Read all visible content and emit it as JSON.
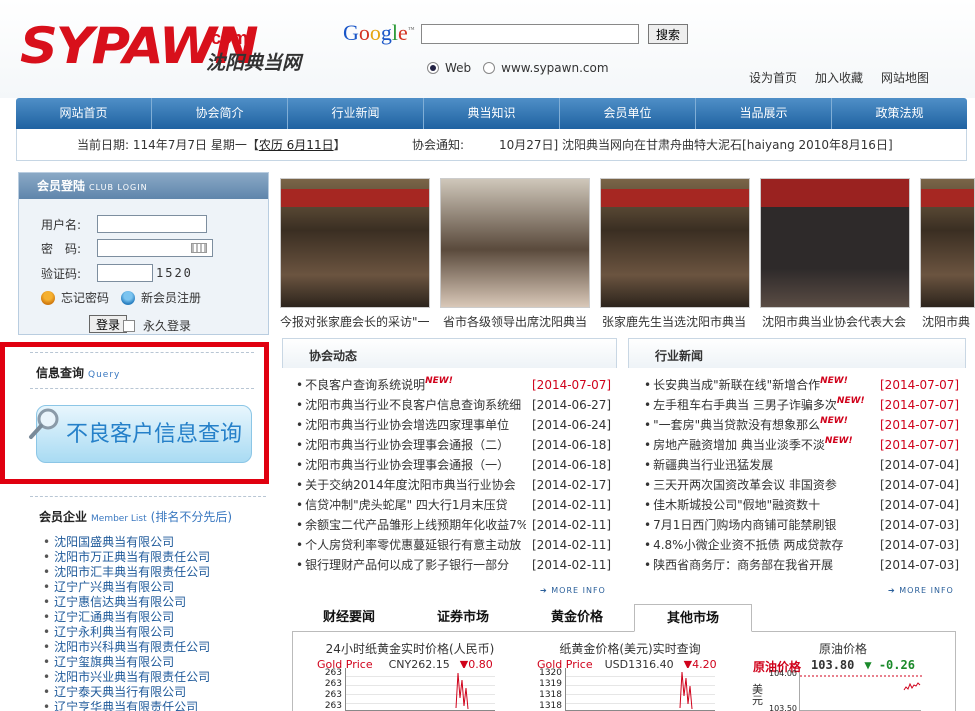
{
  "header": {
    "logo_main": "SYPAWN",
    "logo_com": ".com",
    "logo_cn": "沈阳典当网",
    "google_logo": "Google",
    "search_button": "搜索",
    "radio_web": "Web",
    "radio_site": "www.sypawn.com",
    "links": [
      "设为首页",
      "加入收藏",
      "网站地图"
    ]
  },
  "nav": [
    "网站首页",
    "协会简介",
    "行业新闻",
    "典当知识",
    "会员单位",
    "当品展示",
    "政策法规"
  ],
  "infobar": {
    "date_prefix": "当前日期: 114年7月7日 星期一【",
    "lunar_date": "农历 6月11日",
    "date_suffix": "】",
    "notice_label": "协会通知:",
    "notice_text": "10月27日] 沈阳典当网向在甘肃舟曲特大泥石[haiyang 2010年8月16日]"
  },
  "login": {
    "title": "会员登陆",
    "title_en": "CLUB LOGIN",
    "username_label": "用户名:",
    "password_label": "密　码:",
    "captcha_label": "验证码:",
    "captcha_code": "1520",
    "forgot": "忘记密码",
    "register": "新会员注册",
    "login_button": "登录",
    "remember": "永久登录"
  },
  "query": {
    "title": "信息查询",
    "title_en": "Query",
    "button": "不良客户信息查询"
  },
  "members": {
    "title": "会员企业",
    "title_en": "Member List",
    "note": "(排名不分先后)",
    "items": [
      "沈阳国盛典当有限公司",
      "沈阳市万正典当有限责任公司",
      "沈阳市汇丰典当有限责任公司",
      "辽宁广兴典当有限公司",
      "辽宁惠信达典当有限公司",
      "辽宁汇通典当有限公司",
      "辽宁永利典当有限公司",
      "沈阳市兴科典当有限责任公司",
      "辽宁玺旗典当有限公司",
      "沈阳市兴业典当有限责任公司",
      "辽宁泰天典当行有限公司",
      "辽宁亨华典当有限责任公司"
    ]
  },
  "photos": [
    "今报对张家鹿会长的采访\"一",
    "省市各级领导出席沈阳典当",
    "张家鹿先生当选沈阳市典当",
    "沈阳市典当业协会代表大会",
    "沈阳市典"
  ],
  "association_news": {
    "title": "协会动态",
    "new_tag": "NEW!",
    "items": [
      {
        "text": "不良客户查询系统说明",
        "date": "[2014-07-07]",
        "new": true
      },
      {
        "text": "沈阳市典当行业不良客户信息查询系统细",
        "date": "[2014-06-27]",
        "new": false
      },
      {
        "text": "沈阳市典当行业协会增选四家理事单位",
        "date": "[2014-06-24]",
        "new": false
      },
      {
        "text": "沈阳市典当行业协会理事会通报（二）",
        "date": "[2014-06-18]",
        "new": false
      },
      {
        "text": "沈阳市典当行业协会理事会通报（一）",
        "date": "[2014-06-18]",
        "new": false
      },
      {
        "text": "关于交纳2014年度沈阳市典当行业协会",
        "date": "[2014-02-17]",
        "new": false
      },
      {
        "text": "信贷冲制\"虎头蛇尾\" 四大行1月末压贷",
        "date": "[2014-02-11]",
        "new": false
      },
      {
        "text": "余额宝二代产品雏形上线预期年化收益7%",
        "date": "[2014-02-11]",
        "new": false
      },
      {
        "text": "个人房贷利率零优惠蔓延银行有意主动放",
        "date": "[2014-02-11]",
        "new": false
      },
      {
        "text": "银行理财产品何以成了影子银行一部分",
        "date": "[2014-02-11]",
        "new": false
      }
    ],
    "more": "MORE INFO"
  },
  "industry_news": {
    "title": "行业新闻",
    "items": [
      {
        "text": "长安典当成\"新联在线\"新增合作",
        "date": "[2014-07-07]",
        "new": true
      },
      {
        "text": "左手租车右手典当 三男子诈骗多次",
        "date": "[2014-07-07]",
        "new": true
      },
      {
        "text": "\"一套房\"典当贷款没有想象那么",
        "date": "[2014-07-07]",
        "new": true
      },
      {
        "text": "房地产融资增加 典当业淡季不淡",
        "date": "[2014-07-07]",
        "new": true
      },
      {
        "text": "新疆典当行业迅猛发展",
        "date": "[2014-07-04]",
        "new": false
      },
      {
        "text": "三天开两次国资改革会议 非国资参",
        "date": "[2014-07-04]",
        "new": false
      },
      {
        "text": "佳木斯城投公司\"假地\"融资数十",
        "date": "[2014-07-04]",
        "new": false
      },
      {
        "text": "7月1日西门购场内商铺可能禁刷银",
        "date": "[2014-07-03]",
        "new": false
      },
      {
        "text": "4.8%小微企业资不抵债 两成贷款存",
        "date": "[2014-07-03]",
        "new": false
      },
      {
        "text": "陕西省商务厅：商务部在我省开展",
        "date": "[2014-07-03]",
        "new": false
      }
    ],
    "more": "MORE INFO"
  },
  "market_tabs": [
    "财经要闻",
    "证券市场",
    "黄金价格",
    "其他市场"
  ],
  "market": {
    "paper_gold_rmb": {
      "title": "24小时纸黄金实时价格(人民币)",
      "label": "Gold Price",
      "price": "CNY262.15",
      "change": "0.80",
      "ticks": [
        "263",
        "263",
        "263",
        "263"
      ]
    },
    "paper_gold_usd": {
      "title": "纸黄金价格(美元)实时查询",
      "label": "Gold Price",
      "price": "USD1316.40",
      "change": "4.20",
      "ticks": [
        "1320",
        "1319",
        "1318",
        "1318"
      ]
    },
    "oil": {
      "title": "原油价格",
      "label": "原油价格",
      "price": "103.80",
      "change": "-0.26",
      "ticks": [
        "104.00",
        "103.50"
      ],
      "unit": "美元"
    }
  }
}
